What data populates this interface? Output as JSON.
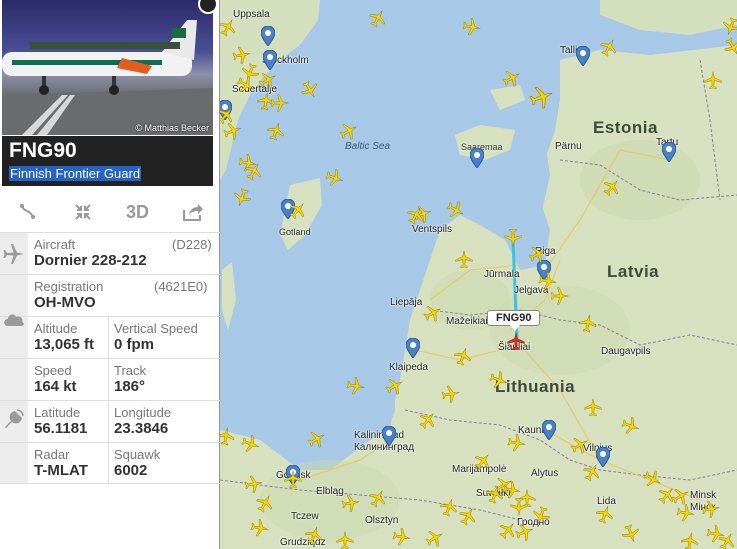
{
  "flight": {
    "callsign": "FNG90",
    "operator": "Finnish Frontier Guard",
    "photo_credit": "© Matthias Becker",
    "tag": "FNG90"
  },
  "toolbar": {
    "route_icon": "route-icon",
    "collapse_icon": "collapse-arrows-icon",
    "view3d_label": "3D",
    "share_icon": "share-icon"
  },
  "info": {
    "aircraft_label": "Aircraft",
    "aircraft_code": "(D228)",
    "aircraft_value": "Dornier 228-212",
    "registration_label": "Registration",
    "registration_code": "(4621E0)",
    "registration_value": "OH-MVO",
    "altitude_label": "Altitude",
    "altitude_value": "13,065 ft",
    "vspeed_label": "Vertical Speed",
    "vspeed_value": "0 fpm",
    "speed_label": "Speed",
    "speed_value": "164 kt",
    "track_label": "Track",
    "track_value": "186°",
    "lat_label": "Latitude",
    "lat_value": "56.1181",
    "lon_label": "Longitude",
    "lon_value": "23.3846",
    "radar_label": "Radar",
    "radar_value": "T-MLAT",
    "squawk_label": "Squawk",
    "squawk_value": "6002"
  },
  "map": {
    "countries": {
      "estonia": "Estonia",
      "latvia": "Latvia",
      "lithuania": "Lithuania"
    },
    "seas": {
      "baltic": "Baltic Sea"
    },
    "islands": {
      "saaremaa": "Saaremaa",
      "gotland": "Gotland"
    },
    "cities": {
      "uppsala": "Uppsala",
      "stockholm": "Stockholm",
      "sodertalje": "Sodertalje",
      "tallinn": "Tallinn",
      "parnu": "Pärnu",
      "tartu": "Tartu",
      "ventspils": "Ventspils",
      "riga": "Riga",
      "jurmala": "Jūrmala",
      "jelgava": "Jelgava",
      "liepaja": "Liepāja",
      "mazeikiai": "Mažeikiai",
      "siauliai": "Šiauliai",
      "daugavpils": "Daugavpils",
      "klaipeda": "Klaipeda",
      "kaliningrad": "Kaliningrad",
      "kaliningrad_ru": "Калининград",
      "kaunas": "Kaunas",
      "vilnius": "Vilnius",
      "marijampole": "Marijampolė",
      "alytus": "Alytus",
      "suwalki": "Suwałki",
      "grodno": "Гродно",
      "gdansk": "Gdańsk",
      "elblag": "Elbląg",
      "tczew": "Tczew",
      "olsztyn": "Olsztyn",
      "grudziadz": "Grudziądz",
      "lida": "Lida",
      "minsk": "Minsk",
      "minsk_ru": "Мінск"
    }
  },
  "colors": {
    "sea": "#a8c8e8",
    "land": "#d9e3c2",
    "plane": "#f5d400",
    "track_line": "#34c6e0",
    "operator_highlight": "#2364c4"
  }
}
